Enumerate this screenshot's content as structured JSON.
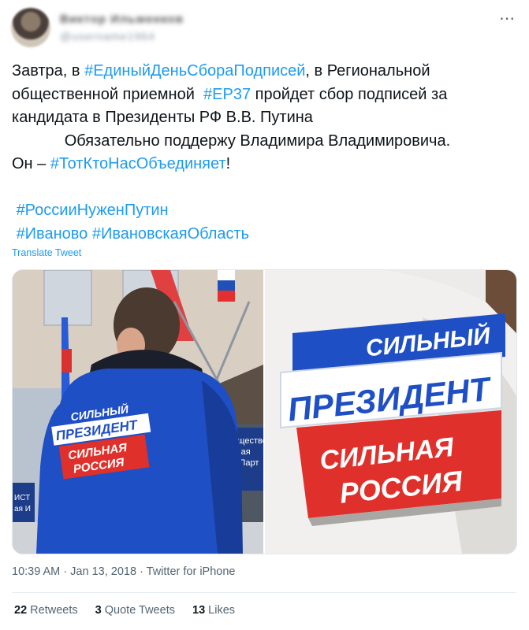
{
  "author": {
    "name": "Виктор Ильменков",
    "handle": "@username1964"
  },
  "tweet": {
    "line1_a": "Завтра, в ",
    "hashtag1": "#ЕдиныйДеньСбораПодписей",
    "line1_b": ", в Региональной",
    "line2_a": "общественной приемной  ",
    "hashtag2": "#ЕР37",
    "line2_b": " пройдет сбор подписей за",
    "line3": "кандидата в Президенты РФ В.В. Путина",
    "line4": "            Обязательно поддержу Владимира Владимировича.",
    "line5_a": "Он – ",
    "hashtag3": "#ТотКтоНасОбъединяет",
    "line5_b": "!",
    "hashtag4": "#РоссииНуженПутин",
    "hashtag5": "#Иваново",
    "hashtag6": "#ИвановскаяОбласть"
  },
  "translate_label": "Translate Tweet",
  "media": {
    "left_badge": {
      "line1": "СИЛЬНЫЙ",
      "line2": "ПРЕЗИДЕНТ",
      "line3": "СИЛЬНАЯ",
      "line4": "РОССИЯ"
    },
    "left_sign": [
      "обществе",
      "мная",
      "ля Парт"
    ],
    "left_plaque": [
      "ИСТ",
      "ая И"
    ],
    "right_badge": {
      "line1": "СИЛЬНЫЙ",
      "line2": "ПРЕЗИДЕНТ",
      "line3": "СИЛЬНАЯ",
      "line4": "РОССИЯ"
    }
  },
  "meta": {
    "time": "10:39 AM",
    "sep1": " · ",
    "date": "Jan 13, 2018",
    "sep2": " · ",
    "source": "Twitter for iPhone"
  },
  "stats": {
    "retweets_count": "22",
    "retweets_label": "Retweets",
    "quotes_count": "3",
    "quotes_label": "Quote Tweets",
    "likes_count": "13",
    "likes_label": "Likes"
  },
  "colors": {
    "link": "#1d9bf0",
    "jacket_blue": "#1f4fc4",
    "banner_red": "#e0302b"
  },
  "icons": {
    "more": "more-horizontal-icon"
  }
}
